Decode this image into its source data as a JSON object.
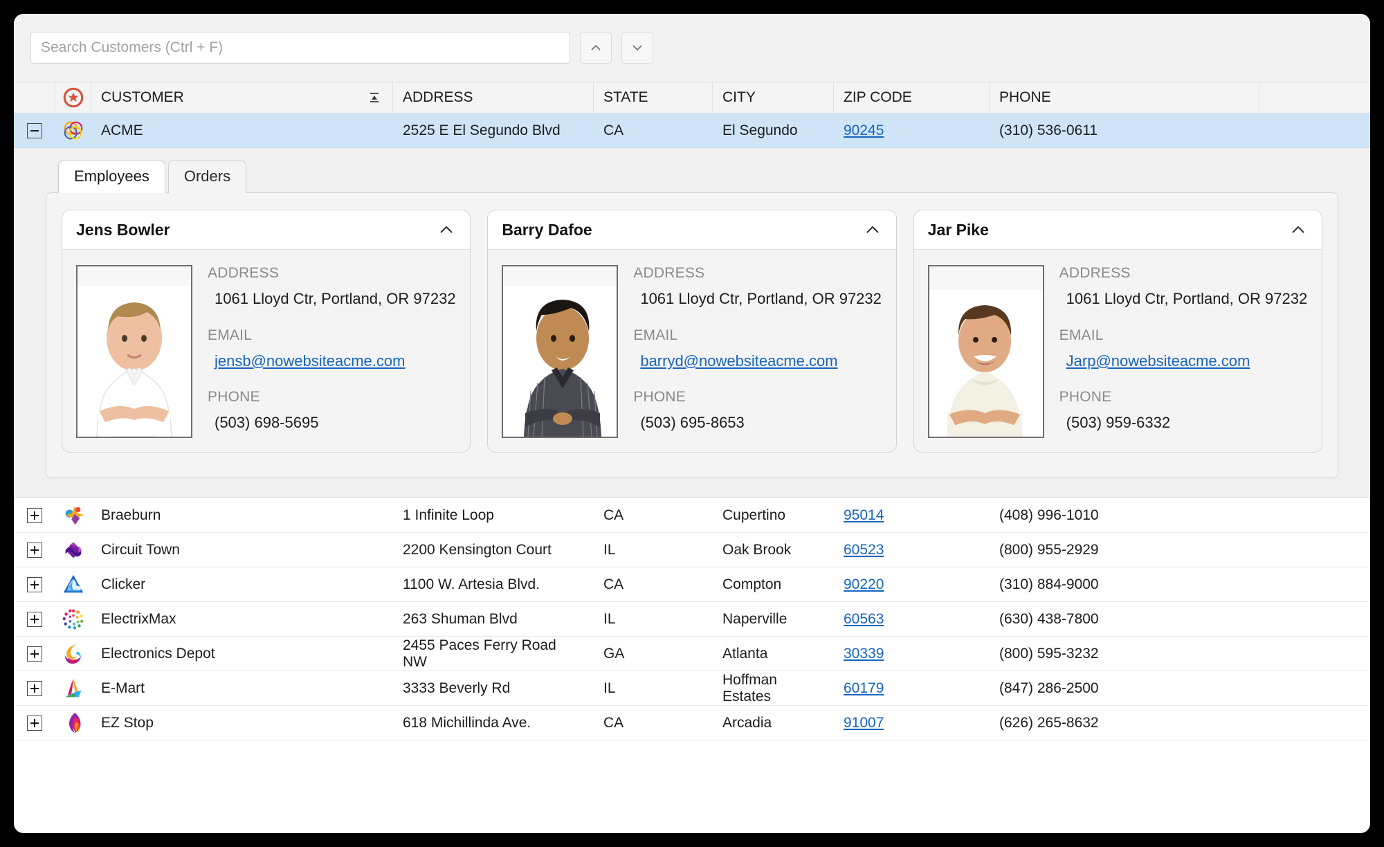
{
  "search": {
    "placeholder": "Search Customers (Ctrl + F)",
    "value": "",
    "prev_label": "Previous match",
    "next_label": "Next match"
  },
  "grid": {
    "columns": [
      {
        "key": "expander",
        "label": ""
      },
      {
        "key": "indicator",
        "label": ""
      },
      {
        "key": "customer",
        "label": "CUSTOMER"
      },
      {
        "key": "address",
        "label": "ADDRESS"
      },
      {
        "key": "state",
        "label": "STATE"
      },
      {
        "key": "city",
        "label": "CITY"
      },
      {
        "key": "zip",
        "label": "ZIP CODE"
      },
      {
        "key": "phone",
        "label": "PHONE"
      }
    ],
    "selected_row": {
      "customer": "ACME",
      "address": "2525 E El Segundo Blvd",
      "state": "CA",
      "city": "El Segundo",
      "zip": "90245",
      "phone": "(310) 536-0611",
      "expanded": true
    },
    "rows": [
      {
        "customer": "Braeburn",
        "address": "1 Infinite Loop",
        "state": "CA",
        "city": "Cupertino",
        "zip": "95014",
        "phone": "(408) 996-1010"
      },
      {
        "customer": "Circuit Town",
        "address": "2200 Kensington Court",
        "state": "IL",
        "city": "Oak Brook",
        "zip": "60523",
        "phone": "(800) 955-2929"
      },
      {
        "customer": "Clicker",
        "address": "1100 W. Artesia Blvd.",
        "state": "CA",
        "city": "Compton",
        "zip": "90220",
        "phone": "(310) 884-9000"
      },
      {
        "customer": "ElectrixMax",
        "address": "263 Shuman Blvd",
        "state": "IL",
        "city": "Naperville",
        "zip": "60563",
        "phone": "(630) 438-7800"
      },
      {
        "customer": "Electronics Depot",
        "address": "2455 Paces Ferry Road NW",
        "state": "GA",
        "city": "Atlanta",
        "zip": "30339",
        "phone": "(800) 595-3232"
      },
      {
        "customer": "E-Mart",
        "address": "3333 Beverly Rd",
        "state": "IL",
        "city": "Hoffman Estates",
        "zip": "60179",
        "phone": "(847) 286-2500"
      },
      {
        "customer": "EZ Stop",
        "address": "618 Michillinda Ave.",
        "state": "CA",
        "city": "Arcadia",
        "zip": "91007",
        "phone": "(626) 265-8632"
      }
    ]
  },
  "detail": {
    "tabs": [
      {
        "label": "Employees",
        "active": true
      },
      {
        "label": "Orders",
        "active": false
      }
    ],
    "field_labels": {
      "address": "ADDRESS",
      "email": "EMAIL",
      "phone": "PHONE"
    },
    "employees": [
      {
        "name": "Jens Bowler",
        "address": "1061 Lloyd Ctr, Portland, OR 97232",
        "email": "jensb@nowebsiteacme.com",
        "phone": "(503) 698-5695"
      },
      {
        "name": "Barry Dafoe",
        "address": "1061 Lloyd Ctr, Portland, OR 97232",
        "email": "barryd@nowebsiteacme.com",
        "phone": "(503) 695-8653"
      },
      {
        "name": "Jar Pike",
        "address": "1061 Lloyd Ctr, Portland, OR 97232",
        "email": "Jarp@nowebsiteacme.com",
        "phone": "(503) 959-6332"
      }
    ]
  },
  "colors": {
    "selection": "#cfe4f7",
    "link": "#1565c0",
    "indicator": "#d9533b",
    "header_bg": "#f4f4f4"
  }
}
